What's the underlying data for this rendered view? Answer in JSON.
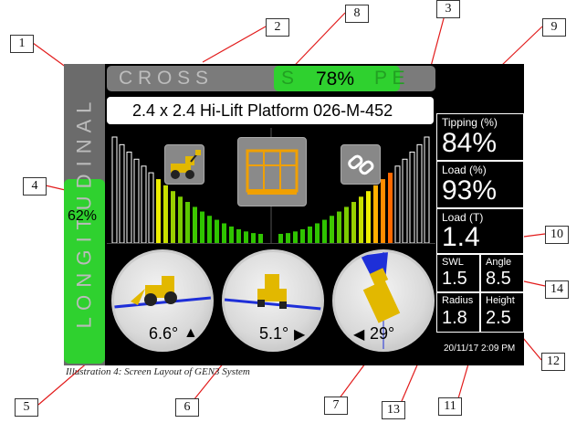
{
  "callouts": [
    "1",
    "2",
    "8",
    "3",
    "9",
    "4",
    "10",
    "14",
    "5",
    "6",
    "7",
    "13",
    "11",
    "12"
  ],
  "caption": "Illustration 4: Screen Layout of GEN3 System",
  "header": {
    "cross_text": "C R O S S",
    "cross_tail": "S",
    "cross_tail2": "P E",
    "cross_percent": "78%",
    "platform_name": "2.4 x 2.4 Hi-Lift Platform 026-M-452"
  },
  "longitudinal": {
    "text": "L O N G I T U D I N A L",
    "percent": "62%",
    "level": 0.62
  },
  "bars": {
    "left": [
      "#ffffff",
      "#ffffff",
      "#ffffff",
      "#ffffff",
      "#ffffff",
      "#ffffff",
      "#eeee00",
      "#c8e000",
      "#9ad000",
      "#7ccc00",
      "#5bc800",
      "#3ec800",
      "#2fc400",
      "#2fc400",
      "#2fc400",
      "#2fc400",
      "#2fc400",
      "#2fc400",
      "#2fc400",
      "#2fc400",
      "#2fc400"
    ],
    "right": [
      "#2fc400",
      "#2fc400",
      "#2fc400",
      "#2fc400",
      "#2fc400",
      "#2fc400",
      "#2fc400",
      "#3ec800",
      "#5bc800",
      "#7ccc00",
      "#9ad000",
      "#c8e000",
      "#eeee00",
      "#ffb000",
      "#ff8c00",
      "#ff6a00",
      "#ffffff",
      "#ffffff",
      "#ffffff",
      "#ffffff",
      "#ffffff"
    ]
  },
  "icons": {
    "loader": "loader-icon",
    "platform": "platform-icon",
    "chain": "chain-link-icon"
  },
  "gauges": {
    "pitch": {
      "value": "6.6°",
      "arrow": "▲"
    },
    "roll": {
      "value": "5.1°",
      "arrow": "▶"
    },
    "slew": {
      "value": "29°",
      "arrow": "◀"
    }
  },
  "readouts": {
    "tipping_label": "Tipping (%)",
    "tipping_value": "84%",
    "load_pct_label": "Load (%)",
    "load_pct_value": "93%",
    "load_t_label": "Load (T)",
    "load_t_value": "1.4",
    "swl_label": "SWL",
    "swl_value": "1.5",
    "angle_label": "Angle",
    "angle_value": "8.5",
    "radius_label": "Radius",
    "radius_value": "1.8",
    "height_label": "Height",
    "height_value": "2.5",
    "datetime": "20/11/17 2:09 PM"
  },
  "colors": {
    "green": "#2fd12f",
    "screen": "#000000",
    "warning_red": "#cc0000"
  }
}
